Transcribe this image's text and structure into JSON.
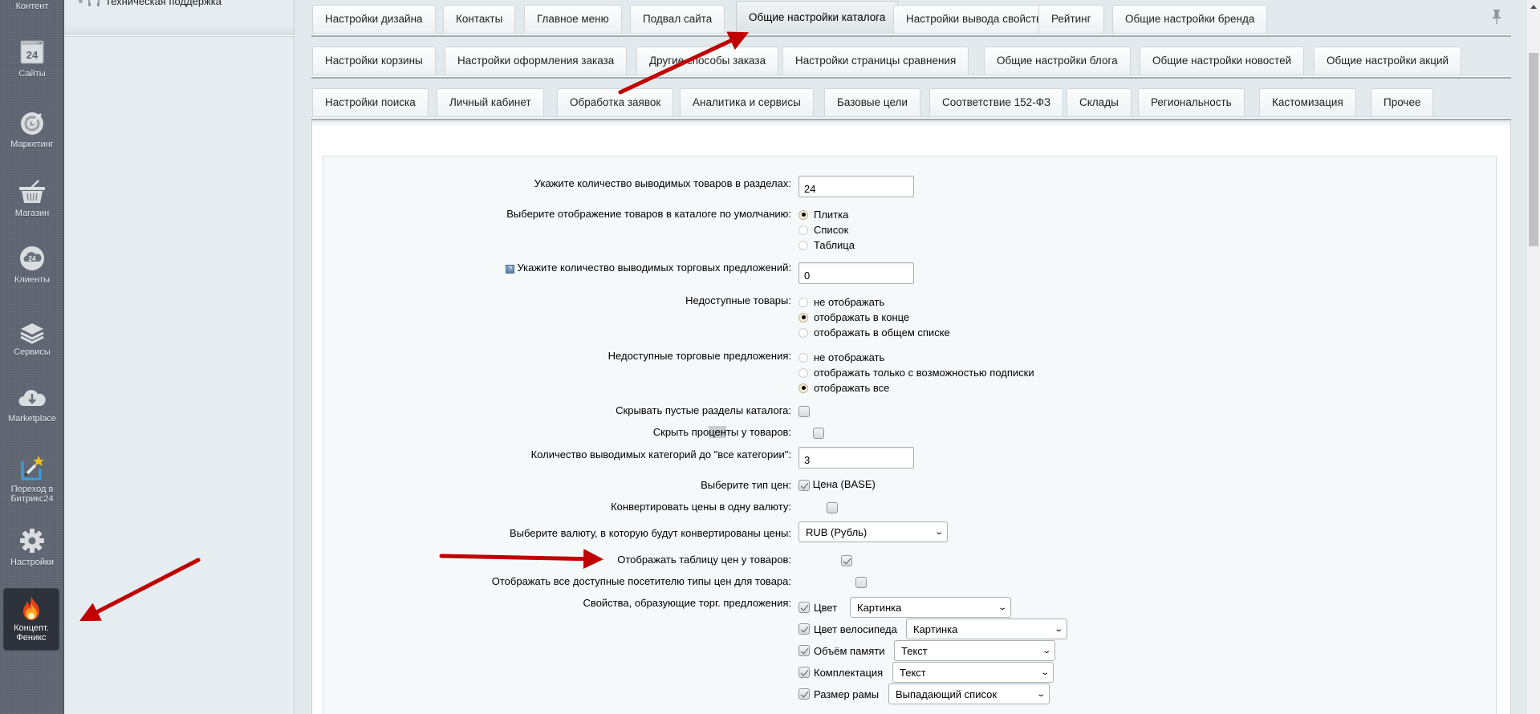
{
  "sidebar": {
    "items": [
      {
        "label": "Контент",
        "icon": "content-icon"
      },
      {
        "label": "Сайты",
        "icon": "sites-icon"
      },
      {
        "label": "Маркетинг",
        "icon": "target-icon"
      },
      {
        "label": "Магазин",
        "icon": "basket-icon"
      },
      {
        "label": "Клиенты",
        "icon": "clients-cloud-icon"
      },
      {
        "label": "Сервисы",
        "icon": "layers-icon"
      },
      {
        "label": "Marketplace",
        "icon": "cloud-download-icon"
      },
      {
        "label": "Переход в Битрикс24",
        "label_line1": "Переход в",
        "label_line2": "Битрикс24",
        "icon": "magic-wand-icon"
      },
      {
        "label": "Настройки",
        "icon": "gear-icon"
      },
      {
        "label": "Концепт. Феникс",
        "label_line1": "Концепт.",
        "label_line2": "Феникс",
        "icon": "flame-icon",
        "active": true
      }
    ],
    "icon_24_text": "24"
  },
  "tree": {
    "items": [
      {
        "label": "Техническая поддержка",
        "icon": "headset-icon"
      }
    ]
  },
  "tabs": {
    "row1": [
      "Настройки дизайна",
      "Контакты",
      "Главное меню",
      "Подвал сайта",
      "Общие настройки каталога",
      "Настройки вывода свойств товаров",
      "Рейтинг",
      "Общие настройки бренда"
    ],
    "row2": [
      "Настройки корзины",
      "Настройки оформления заказа",
      "Другие способы заказа",
      "Настройки страницы сравнения",
      "Общие настройки блога",
      "Общие настройки новостей",
      "Общие настройки акций"
    ],
    "row3": [
      "Настройки поиска",
      "Личный кабинет",
      "Обработка заявок",
      "Аналитика и сервисы",
      "Базовые цели",
      "Соответствие 152-ФЗ",
      "Склады",
      "Региональность",
      "Кастомизация",
      "Прочее"
    ],
    "active": "Общие настройки каталога"
  },
  "form": {
    "items_per_section": {
      "label": "Укажите количество выводимых товаров в разделах:",
      "value": "24"
    },
    "default_view": {
      "label": "Выберите отображение товаров в каталоге по умолчанию:",
      "options": [
        "Плитка",
        "Список",
        "Таблица"
      ],
      "selected": "Плитка"
    },
    "offers_count": {
      "label": "Укажите количество выводимых торговых предложений:",
      "value": "0",
      "help": "?"
    },
    "unavailable_products": {
      "label": "Недоступные товары:",
      "options": [
        "не отображать",
        "отображать в конце",
        "отображать в общем списке"
      ],
      "selected": "отображать в конце"
    },
    "unavailable_offers": {
      "label": "Недоступные торговые предложения:",
      "options": [
        "не отображать",
        "отображать только с возможностью подписки",
        "отображать все"
      ],
      "selected": "отображать все"
    },
    "hide_empty_sections": {
      "label": "Скрывать пустые разделы каталога:",
      "checked": false
    },
    "hide_percent": {
      "label_pre": "Скрыть про",
      "label_hl": "цен",
      "label_post": "ты у товаров:",
      "label": "Скрыть проценты у товаров:",
      "checked": false
    },
    "categories_before_all": {
      "label": "Количество выводимых категорий до \"все категории\":",
      "value": "3"
    },
    "price_type": {
      "label": "Выберите тип цен:",
      "option": "Цена (BASE)",
      "checked": true
    },
    "convert_currency": {
      "label": "Конвертировать цены в одну валюту:",
      "checked": false
    },
    "target_currency": {
      "label": "Выберите валюту, в которую будут конвертированы цены:",
      "value": "RUB (Рубль)"
    },
    "show_price_table": {
      "label": "Отображать таблицу цен у товаров:",
      "checked": true
    },
    "show_all_price_types": {
      "label": "Отображать все доступные посетителю типы цен для товара:",
      "checked": false
    },
    "offer_properties": {
      "label": "Свойства, образующие торг. предложения:",
      "items": [
        {
          "name": "Цвет",
          "checked": true,
          "display": "Картинка"
        },
        {
          "name": "Цвет велосипеда",
          "checked": true,
          "display": "Картинка"
        },
        {
          "name": "Объём памяти",
          "checked": true,
          "display": "Текст"
        },
        {
          "name": "Комплектация",
          "checked": true,
          "display": "Текст"
        },
        {
          "name": "Размер рамы",
          "checked": true,
          "display": "Выпадающий список"
        }
      ]
    }
  },
  "colors": {
    "sidebar_bg": "#5d6470",
    "sidebar_active_bg": "#2e333b",
    "annotation_arrow": "#c00000",
    "panel_bg": "#f5f9fa"
  }
}
